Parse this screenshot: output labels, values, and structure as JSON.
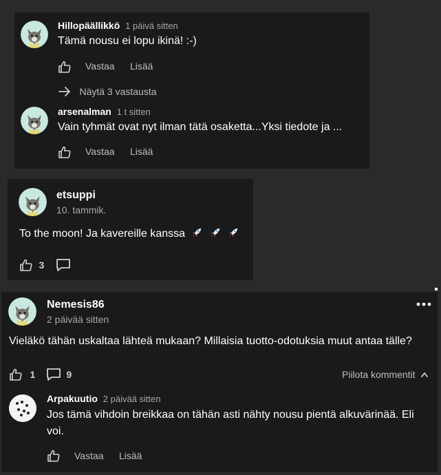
{
  "thread1": {
    "comment1": {
      "author": "Hillopäällikkö",
      "time": "1 päivä sitten",
      "text": "Tämä nousu ei lopu ikinä! :-)",
      "reply_label": "Vastaa",
      "more_label": "Lisää",
      "show_replies": "Näytä 3 vastausta"
    },
    "comment2": {
      "author": "arsenalman",
      "time": "1 t sitten",
      "text": "Vain tyhmät ovat nyt ilman tätä osaketta...Yksi tiedote ja ...",
      "reply_label": "Vastaa",
      "more_label": "Lisää"
    }
  },
  "post1": {
    "author": "etsuppi",
    "date": "10. tammik.",
    "text": "To the moon! Ja kavereille kanssa",
    "like_count": "3"
  },
  "post2": {
    "author": "Nemesis86",
    "time": "2 päivää sitten",
    "text": "Vieläkö tähän uskaltaa lähteä mukaan? Millaisia tuotto-odotuksia muut antaa tälle?",
    "like_count": "1",
    "comment_count": "9",
    "hide_comments_label": "Piilota kommentit",
    "reply": {
      "author": "Arpakuutio",
      "time": "2 päivää sitten",
      "text_line1": "Jos tämä vihdoin breikkaa on tähän asti nähty nousu pientä alkuvärinää. Eli",
      "text_line2": "voi.",
      "reply_label": "Vastaa",
      "more_label": "Lisää"
    }
  },
  "colors": {
    "background": "#2a2a2a",
    "card": "#1a1a1a",
    "text": "#ffffff",
    "muted": "#a8a8a8",
    "avatar_bg": "#c9e9e0"
  }
}
